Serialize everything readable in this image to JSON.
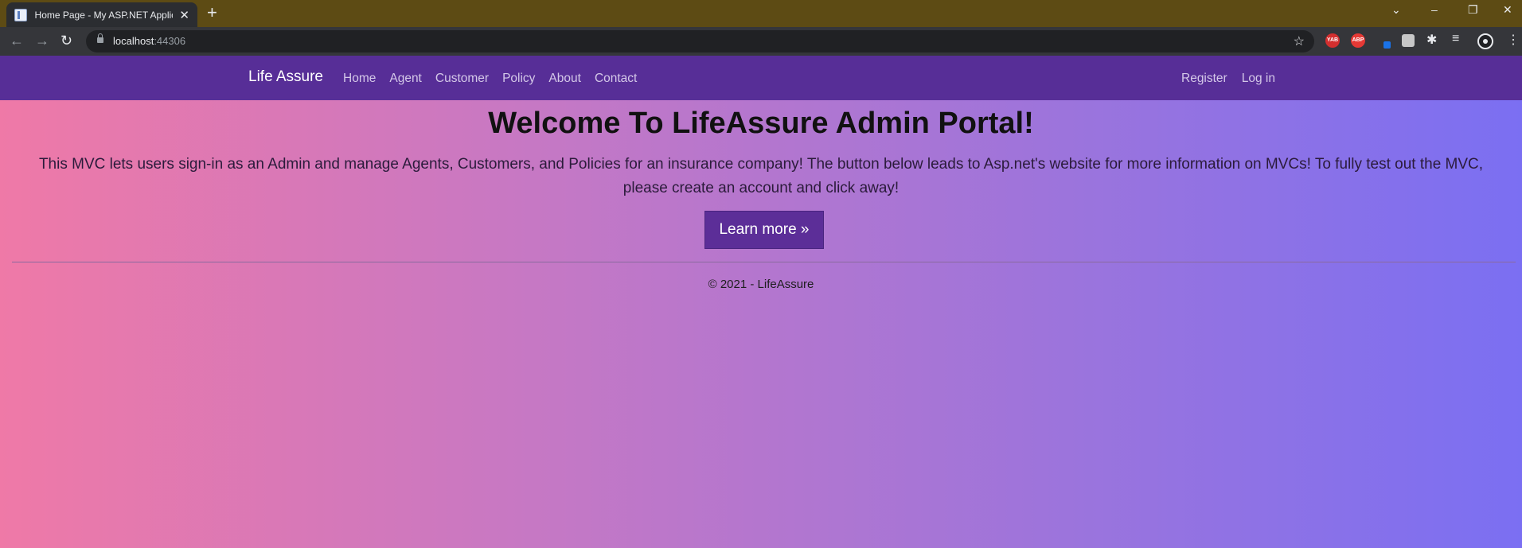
{
  "browser": {
    "tab_title": "Home Page - My ASP.NET Applic",
    "tab_close": "✕",
    "new_tab": "+",
    "url_host": "localhost",
    "url_port": ":44306",
    "window_controls": {
      "tabs_menu": "⌄",
      "minimize": "–",
      "restore": "❐",
      "close": "✕"
    },
    "nav": {
      "back": "←",
      "forward": "→",
      "reload": "↻"
    },
    "star": "☆",
    "extensions": [
      {
        "icon": "yab-extension-icon",
        "label": "YAB",
        "color": "#d32f2f"
      },
      {
        "icon": "abp-extension-icon",
        "label": "ABP",
        "color": "#e53935"
      }
    ],
    "puzzle_icon": "✱",
    "media_icon": "≡",
    "menu_icon": "⋮"
  },
  "site": {
    "brand": "Life Assure",
    "nav_links": [
      "Home",
      "Agent",
      "Customer",
      "Policy",
      "About",
      "Contact"
    ],
    "right_links": [
      "Register",
      "Log in"
    ],
    "heading": "Welcome To LifeAssure Admin Portal!",
    "lead": "This MVC lets users sign-in as an Admin and manage Agents, Customers, and Policies for an insurance company! The button below leads to Asp.net's website for more information on MVCs! To fully test out the MVC, please create an account and click away!",
    "button": "Learn more »",
    "footer": "© 2021 - LifeAssure"
  },
  "colors": {
    "navbar": "#572e97",
    "button": "#5c2e98",
    "gradient_start": "#ef79a7",
    "gradient_end": "#7b6ff2"
  }
}
